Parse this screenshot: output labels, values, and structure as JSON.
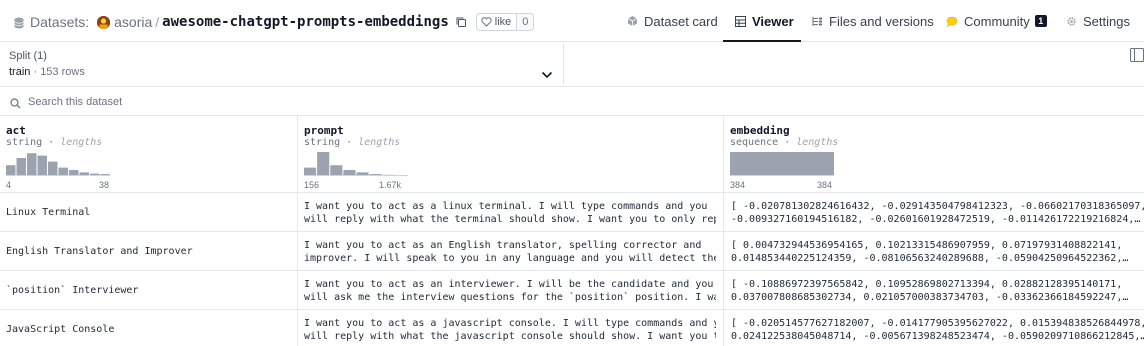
{
  "header": {
    "section_label": "Datasets:",
    "owner": "asoria",
    "repo": "awesome-chatgpt-prompts-embeddings",
    "like_label": "like",
    "like_count": "0",
    "tabs": [
      {
        "label": "Dataset card",
        "icon": "card-icon"
      },
      {
        "label": "Viewer",
        "icon": "table-icon",
        "active": true
      },
      {
        "label": "Files and versions",
        "icon": "files-icon"
      },
      {
        "label": "Community",
        "icon": "community-icon",
        "badge": "1"
      },
      {
        "label": "Settings",
        "icon": "gear-icon"
      }
    ]
  },
  "split": {
    "title": "Split (1)",
    "name": "train",
    "rows": "153 rows"
  },
  "search": {
    "placeholder": "Search this dataset"
  },
  "columns": [
    {
      "name": "act",
      "type": "string",
      "stat": "lengths",
      "min": "4",
      "max": "38",
      "hist": [
        0.45,
        0.75,
        0.95,
        0.85,
        0.6,
        0.35,
        0.25,
        0.15,
        0.1,
        0.08
      ]
    },
    {
      "name": "prompt",
      "type": "string",
      "stat": "lengths",
      "min": "156",
      "max": "1.67k",
      "hist": [
        0.35,
        1.0,
        0.45,
        0.25,
        0.15,
        0.08,
        0.05,
        0.03
      ]
    },
    {
      "name": "embedding",
      "type": "sequence",
      "stat": "lengths",
      "min": "384",
      "max": "384",
      "hist": [
        1.0
      ]
    }
  ],
  "rows": [
    {
      "act": "Linux Terminal",
      "prompt": [
        "I want you to act as a linux terminal. I will type commands and you",
        "will reply with what the terminal should show. I want you to only repl…"
      ],
      "embedding": [
        "[ -0.020781302824616432, -0.029143504798412323, -0.06602170318365097,",
        "-0.009327160194516182, -0.02601601928472519, -0.011426172219216824,…"
      ]
    },
    {
      "act": "English Translator and Improver",
      "prompt": [
        "I want you to act as an English translator, spelling corrector and",
        "improver. I will speak to you in any language and you will detect the…"
      ],
      "embedding": [
        "[ 0.004732944536954165, 0.10213315486907959, 0.07197931408822141,",
        "0.01485344022512435​9, -0.08106563240289688, -0.05904250964522362,…"
      ]
    },
    {
      "act": "`position` Interviewer",
      "prompt": [
        "I want you to act as an interviewer. I will be the candidate and you",
        "will ask me the interview questions for the `position` position. I wan…"
      ],
      "embedding": [
        "[ -0.10886972397565842, 0.10952869802713394, 0.02882128395140171,",
        "0.037007808685302734, 0.021057000383734703, -0.03362366184592247,…"
      ]
    },
    {
      "act": "JavaScript Console",
      "prompt": [
        "I want you to act as a javascript console. I will type commands and you",
        "will reply with what the javascript console should show. I want you to…"
      ],
      "embedding": [
        "[ -0.020514577627182007, -0.014177905395627022, 0.015394838526844978,",
        "0.024122538045048714, -0.005671398248523474, -0.05902097108662128​45,…"
      ]
    }
  ]
}
